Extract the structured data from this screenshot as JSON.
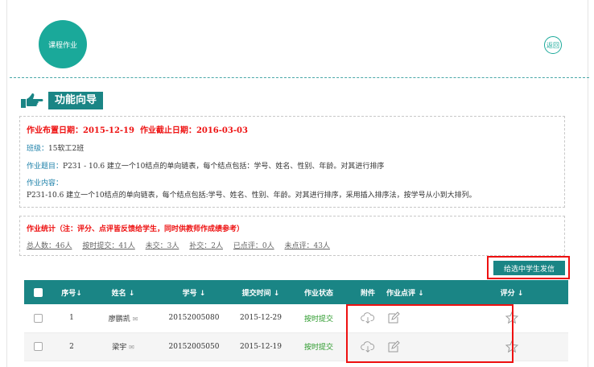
{
  "header": {
    "logo_text": "课程作业",
    "back_label": "返回"
  },
  "guide": {
    "label": "功能向导"
  },
  "info": {
    "assign_date_label": "作业布置日期：",
    "assign_date": "2015-12-19",
    "due_date_label": "作业截止日期：",
    "due_date": "2016-03-03",
    "class_label": "班级：",
    "class_value": "15软工2班",
    "topic_label": "作业题目：",
    "topic_value": "P231 - 10.6 建立一个10结点的单向链表，每个结点包括：学号、姓名、性别、年龄。对其进行排序",
    "content_label": "作业内容：",
    "content_value": "P231-10.6 建立一个10结点的单向链表，每个结点包括:学号、姓名、性别、年龄。对其进行排序，采用插入排序法，按学号从小到大排列。"
  },
  "stats": {
    "title": "作业统计（注：评分、点评皆反馈给学生，同时供教师作成绩参考）",
    "links": [
      "总人数：46人",
      "按时提交：41人",
      "未交：3人",
      "补交：2人",
      "已点评：0人",
      "未点评：43人"
    ]
  },
  "send_button": "给选中学生发信",
  "table": {
    "headers": [
      "序号↓",
      "姓名 ↓",
      "学号 ↓",
      "提交时间 ↓",
      "作业状态",
      "附件",
      "作业点评 ↓",
      "评分 ↓"
    ],
    "rows": [
      {
        "index": "1",
        "name": "廖鹏凯",
        "student_id": "20152005080",
        "time": "2015-12-29",
        "status": "按时提交"
      },
      {
        "index": "2",
        "name": "梁宇",
        "student_id": "20152005050",
        "time": "2015-12-19",
        "status": "按时提交"
      }
    ]
  },
  "colors": {
    "accent": "#1a8585",
    "highlight": "#e11111",
    "date_red": "#e11111",
    "ontime_green": "#2a9a2a"
  }
}
